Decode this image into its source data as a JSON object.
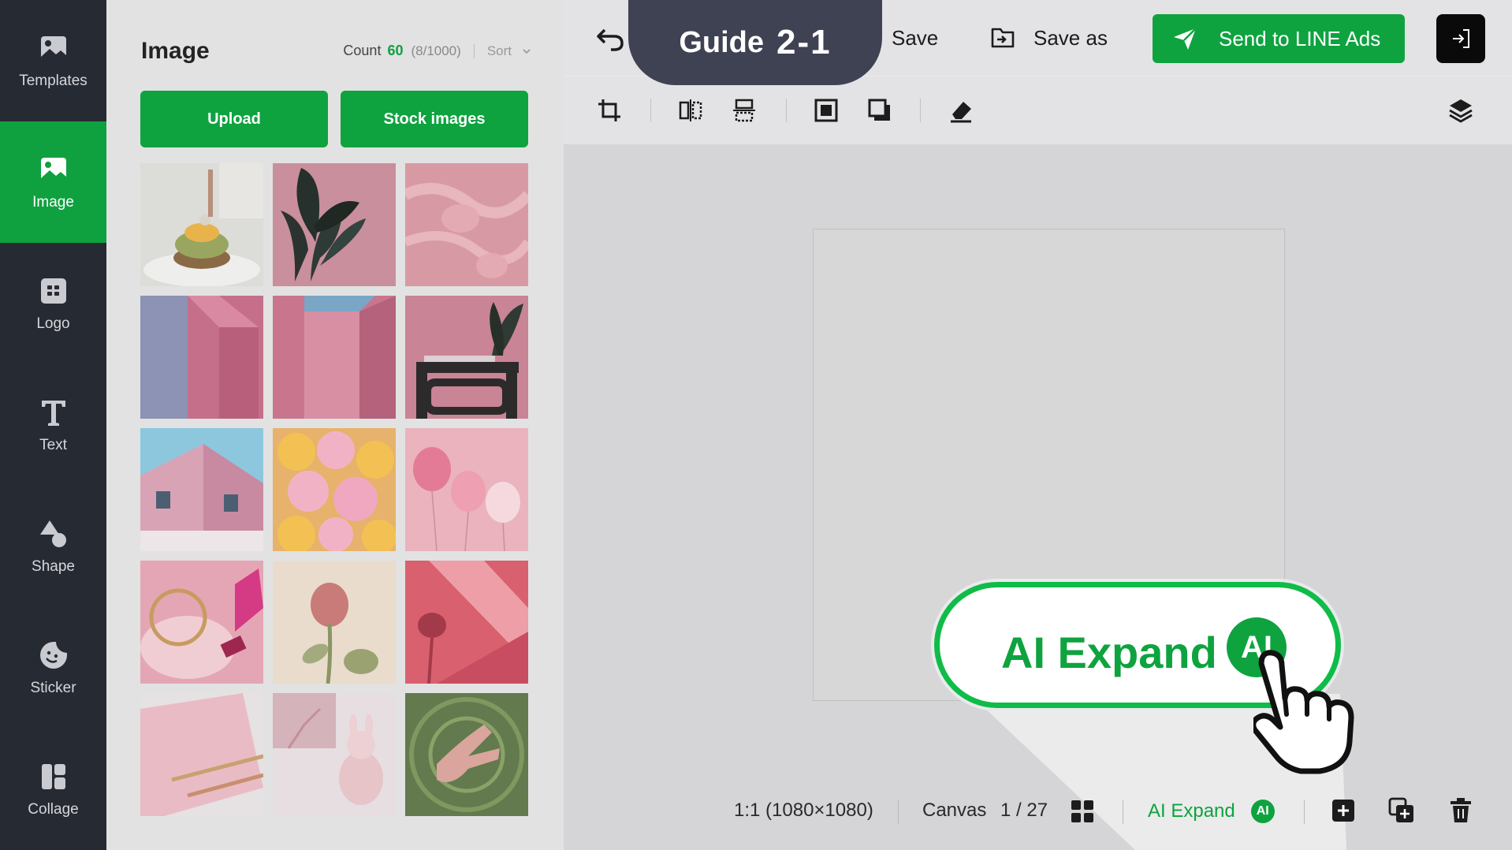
{
  "nav": {
    "items": [
      {
        "label": "Templates",
        "icon": "templates-icon"
      },
      {
        "label": "Image",
        "icon": "image-icon",
        "active": true
      },
      {
        "label": "Logo",
        "icon": "logo-icon"
      },
      {
        "label": "Text",
        "icon": "text-icon"
      },
      {
        "label": "Shape",
        "icon": "shape-icon"
      },
      {
        "label": "Sticker",
        "icon": "sticker-icon"
      },
      {
        "label": "Collage",
        "icon": "collage-icon"
      }
    ]
  },
  "panel": {
    "title": "Image",
    "count_label": "Count",
    "count_value": "60",
    "count_capacity": "(8/1000)",
    "sort_label": "Sort",
    "upload_label": "Upload",
    "stock_label": "Stock images",
    "thumbnails": [
      "food-dish",
      "pink-plant",
      "pink-fabric",
      "pink-wall-blue-sky",
      "pink-building-corner",
      "pink-stool-plant",
      "pink-house-sky",
      "yellow-pink-balloons",
      "pink-balloons",
      "pink-accessories",
      "pink-rose",
      "pink-stripes-shadow",
      "pink-notebook",
      "pink-gift-bunny",
      "water-hand"
    ]
  },
  "topbar": {
    "guide_word": "Guide",
    "guide_number": "2-1",
    "save_label": "Save",
    "save_as_label": "Save as",
    "send_label": "Send to LINE Ads"
  },
  "bottombar": {
    "ratio": "1:1 (1080×1080)",
    "canvas_label": "Canvas",
    "page_indicator": "1 / 27",
    "ai_expand_label": "AI Expand",
    "ai_badge": "AI"
  },
  "callout": {
    "label": "AI Expand",
    "badge": "AI"
  },
  "colors": {
    "brand_green": "#0ea33f",
    "nav_bg": "#262a33",
    "guide_tab": "#3f4253"
  }
}
